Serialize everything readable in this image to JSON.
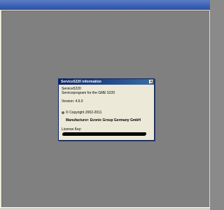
{
  "dialog": {
    "title": "Service5220 information",
    "close_glyph": "×",
    "lines": {
      "app_name": "Service5220",
      "description": "Serviceprogram for the GME 5220",
      "version": "Version: 4.6.0",
      "copyright": "© Copyright 2002-2011",
      "manufacturer": "Manufacturer: Evonic Group Germany GmbH",
      "license_label": "License Key:"
    },
    "license_value_redacted": true
  },
  "colors": {
    "desktop": "#808080",
    "dialog_title_start": "#0a246a",
    "dialog_title_end": "#3a6ea5",
    "dialog_bg": "#ece9d8"
  },
  "icons": {
    "copyright": "copyright-icon"
  }
}
